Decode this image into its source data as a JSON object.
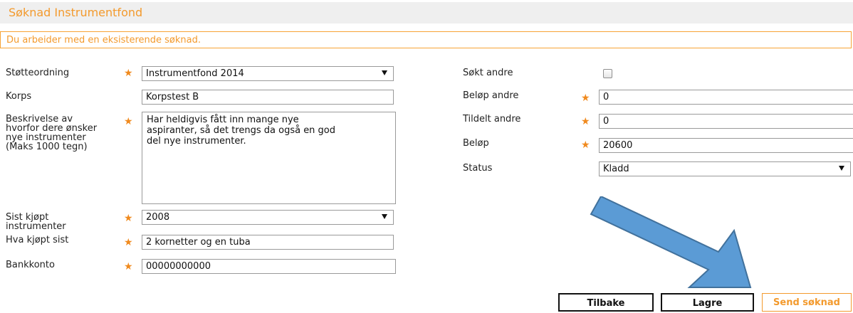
{
  "header": {
    "title": "Søknad Instrumentfond"
  },
  "notice": {
    "text": "Du arbeider med en eksisterende søknad."
  },
  "form_left": {
    "stotteordning": {
      "label": "Støtteordning",
      "value": "Instrumentfond 2014"
    },
    "korps": {
      "label": "Korps",
      "value": "Korpstest B"
    },
    "beskrivelse": {
      "label_lines": [
        "Beskrivelse av",
        "hvorfor dere ønsker",
        "nye instrumenter",
        "(Maks 1000 tegn)"
      ],
      "value_lines": [
        "Har heldigvis fått inn mange nye",
        "aspiranter, så det trengs da også en god",
        "del nye instrumenter."
      ]
    },
    "sist_kjopt": {
      "label_lines": [
        "Sist kjøpt",
        "instrumenter"
      ],
      "value": "2008"
    },
    "hva_kjopt": {
      "label": "Hva kjøpt sist",
      "value": "2 kornetter og en tuba"
    },
    "bankkonto": {
      "label": "Bankkonto",
      "value": "00000000000"
    }
  },
  "form_right": {
    "sokt_andre": {
      "label": "Søkt andre",
      "checked": false
    },
    "belop_andre": {
      "label": "Beløp andre",
      "value": "0"
    },
    "tildelt_andre": {
      "label": "Tildelt andre",
      "value": "0"
    },
    "belop": {
      "label": "Beløp",
      "value": "20600"
    },
    "status": {
      "label": "Status",
      "value": "Kladd"
    }
  },
  "buttons": {
    "back": "Tilbake",
    "save": "Lagre",
    "send": "Send søknad"
  },
  "annotation": {
    "icon": "blue-arrow",
    "color": "#5b9bd5",
    "stroke": "#41719c"
  },
  "required_marker": "★",
  "colors": {
    "accent": "#f39a2d",
    "notice_border": "#f7a335",
    "header_bg": "#efefef"
  }
}
